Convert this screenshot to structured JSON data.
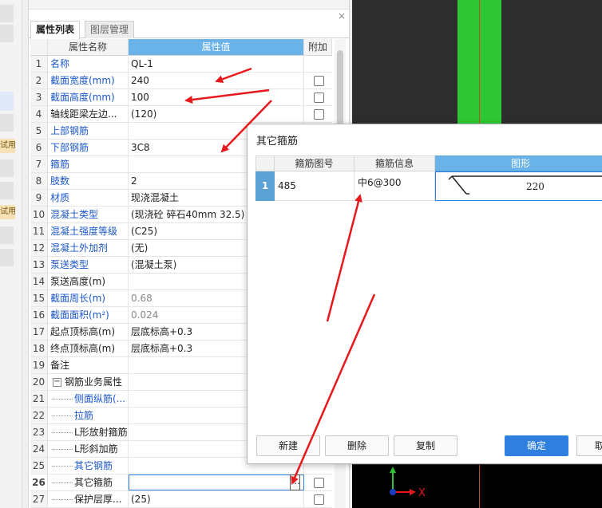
{
  "left_strip": {
    "tags": [
      "试用",
      "试用"
    ]
  },
  "panel": {
    "tabs": [
      "属性列表",
      "图层管理"
    ],
    "close_glyph": "×",
    "headers": {
      "name": "属性名称",
      "value": "属性值",
      "extra": "附加"
    },
    "rows": [
      {
        "num": "1",
        "name": "名称",
        "value": "QL-1",
        "name_style": "blue",
        "check": false
      },
      {
        "num": "2",
        "name": "截面宽度(mm)",
        "value": "240",
        "name_style": "blue",
        "check": true
      },
      {
        "num": "3",
        "name": "截面高度(mm)",
        "value": "100",
        "name_style": "blue",
        "check": true
      },
      {
        "num": "4",
        "name": "轴线距梁左边...",
        "value": "(120)",
        "name_style": "dark",
        "check": true
      },
      {
        "num": "5",
        "name": "上部钢筋",
        "value": "",
        "name_style": "blue",
        "check": false
      },
      {
        "num": "6",
        "name": "下部钢筋",
        "value": "3C8",
        "name_style": "blue",
        "check": false
      },
      {
        "num": "7",
        "name": "箍筋",
        "value": "",
        "name_style": "blue",
        "check": false
      },
      {
        "num": "8",
        "name": "肢数",
        "value": "2",
        "name_style": "blue",
        "check": false
      },
      {
        "num": "9",
        "name": "材质",
        "value": "现浇混凝土",
        "name_style": "blue",
        "check": false
      },
      {
        "num": "10",
        "name": "混凝土类型",
        "value": "(现浇砼 碎石40mm 32.5)",
        "name_style": "blue",
        "check": false
      },
      {
        "num": "11",
        "name": "混凝土强度等级",
        "value": "(C25)",
        "name_style": "blue",
        "check": false
      },
      {
        "num": "12",
        "name": "混凝土外加剂",
        "value": "(无)",
        "name_style": "blue",
        "check": false
      },
      {
        "num": "13",
        "name": "泵送类型",
        "value": "(混凝土泵)",
        "name_style": "blue",
        "check": false
      },
      {
        "num": "14",
        "name": "泵送高度(m)",
        "value": "",
        "name_style": "dark",
        "check": false
      },
      {
        "num": "15",
        "name": "截面周长(m)",
        "value": "0.68",
        "name_style": "blue",
        "value_style": "gray",
        "check": false
      },
      {
        "num": "16",
        "name": "截面面积(m²)",
        "value": "0.024",
        "name_style": "blue",
        "value_style": "gray",
        "check": false
      },
      {
        "num": "17",
        "name": "起点顶标高(m)",
        "value": "层底标高+0.3",
        "name_style": "dark",
        "check": false
      },
      {
        "num": "18",
        "name": "终点顶标高(m)",
        "value": "层底标高+0.3",
        "name_style": "dark",
        "check": false
      },
      {
        "num": "19",
        "name": "备注",
        "value": "",
        "name_style": "dark",
        "check": false
      },
      {
        "num": "20",
        "name": "钢筋业务属性",
        "value": "",
        "name_style": "dark",
        "group": true,
        "check": false
      },
      {
        "num": "21",
        "name": "侧面纵筋(...",
        "value": "",
        "name_style": "blue",
        "child": true,
        "check": false
      },
      {
        "num": "22",
        "name": "拉筋",
        "value": "",
        "name_style": "blue",
        "child": true,
        "check": false
      },
      {
        "num": "23",
        "name": "L形放射箍筋",
        "value": "",
        "name_style": "dark",
        "child": true,
        "check": false
      },
      {
        "num": "24",
        "name": "L形斜加筋",
        "value": "",
        "name_style": "dark",
        "child": true,
        "check": false
      },
      {
        "num": "25",
        "name": "其它钢筋",
        "value": "",
        "name_style": "blue",
        "child": true,
        "check": false
      },
      {
        "num": "26",
        "name": "其它箍筋",
        "value": "",
        "name_style": "dark",
        "child": true,
        "selected": true,
        "check": true
      },
      {
        "num": "27",
        "name": "保护层厚...",
        "value": "(25)",
        "name_style": "dark",
        "child": true,
        "check": true
      }
    ]
  },
  "dialog": {
    "title": "其它箍筋",
    "headers": [
      "箍筋图号",
      "箍筋信息",
      "图形"
    ],
    "rows": [
      {
        "num": "1",
        "code": "485",
        "info": "中6@300",
        "shape_value": "220"
      }
    ],
    "buttons": {
      "new": "新建",
      "delete": "删除",
      "copy": "复制",
      "ok": "确定",
      "cancel": "取消"
    }
  },
  "colors": {
    "header_blue": "#6ab3e8",
    "accent_blue": "#2f7fe0",
    "green_beam": "#2ec633",
    "arrow_red": "#e8191d"
  },
  "axis": {
    "x_label": "X"
  }
}
